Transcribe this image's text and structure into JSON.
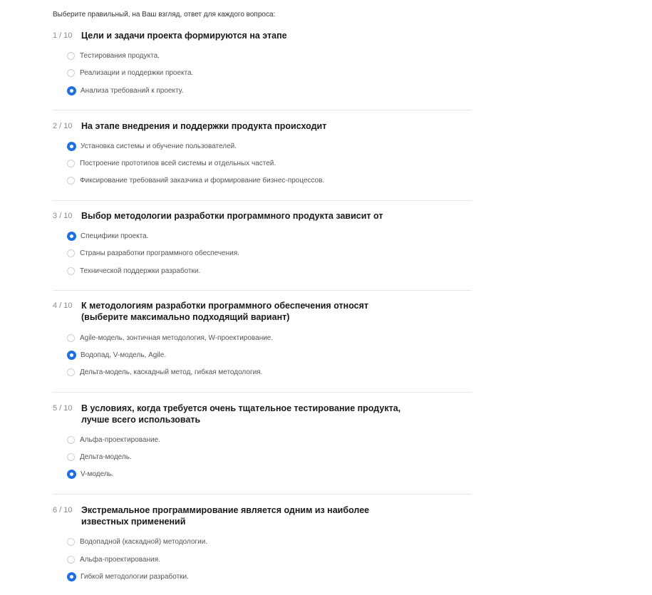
{
  "instructions": "Выберите правильный, на Ваш взгляд, ответ для каждого вопроса:",
  "questions": [
    {
      "number": "1 / 10",
      "text": "Цели и задачи проекта формируются на этапе",
      "options": [
        {
          "label": "Тестирования продукта.",
          "selected": false
        },
        {
          "label": "Реализации и поддержки проекта.",
          "selected": false
        },
        {
          "label": "Анализа требований к проекту.",
          "selected": true
        }
      ]
    },
    {
      "number": "2 / 10",
      "text": "На этапе внедрения и поддержки продукта происходит",
      "options": [
        {
          "label": "Установка системы и обучение пользователей.",
          "selected": true
        },
        {
          "label": "Построение прототипов всей системы и отдельных частей.",
          "selected": false
        },
        {
          "label": "Фиксирование требований заказчика и формирование бизнес-процессов.",
          "selected": false
        }
      ]
    },
    {
      "number": "3 / 10",
      "text": "Выбор методологии разработки программного продукта зависит от",
      "options": [
        {
          "label": "Специфики проекта.",
          "selected": true
        },
        {
          "label": "Страны разработки программного обеспечения.",
          "selected": false
        },
        {
          "label": "Технической поддержки разработки.",
          "selected": false
        }
      ]
    },
    {
      "number": "4 / 10",
      "text": "К методологиям разработки программного обеспечения относят (выберите максимально подходящий вариант)",
      "options": [
        {
          "label": "Agile-модель, зонтичная методология, W-проектирование.",
          "selected": false
        },
        {
          "label": "Водопад, V-модель, Agile.",
          "selected": true
        },
        {
          "label": "Дельта-модель, каскадный метод, гибкая методология.",
          "selected": false
        }
      ]
    },
    {
      "number": "5 / 10",
      "text": "В условиях, когда требуется очень тщательное тестирование продукта, лучше всего использовать",
      "options": [
        {
          "label": "Альфа-проектирование.",
          "selected": false
        },
        {
          "label": "Дельта-модель.",
          "selected": false
        },
        {
          "label": "V-модель.",
          "selected": true
        }
      ]
    },
    {
      "number": "6 / 10",
      "text": "Экстремальное программирование является одним из наиболее известных применений",
      "options": [
        {
          "label": "Водопадной (каскадной) методологии.",
          "selected": false
        },
        {
          "label": "Альфа-проектирования.",
          "selected": false
        },
        {
          "label": "Гибкой методологии разработки.",
          "selected": true
        }
      ]
    }
  ],
  "colors": {
    "accent": "#1e6fe0",
    "divider": "#e6e6e6",
    "muted_text": "#8a8a8a"
  }
}
